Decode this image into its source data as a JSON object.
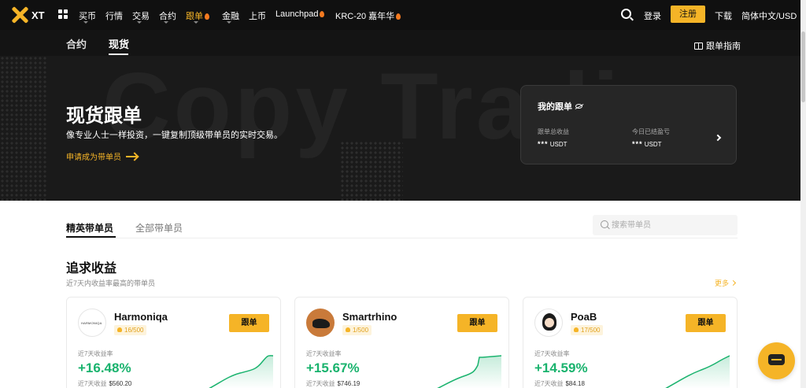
{
  "topnav": {
    "logo": "XT",
    "items": [
      {
        "label": "买币",
        "caret": true
      },
      {
        "label": "行情",
        "caret": false
      },
      {
        "label": "交易",
        "caret": true
      },
      {
        "label": "合约",
        "caret": true
      },
      {
        "label": "跟单",
        "caret": true,
        "active": true,
        "flame": true
      },
      {
        "label": "金融",
        "caret": true
      },
      {
        "label": "上币",
        "caret": false
      },
      {
        "label": "Launchpad",
        "caret": false,
        "flame": true
      },
      {
        "label": "KRC-20 嘉年华",
        "caret": false,
        "flame": true
      }
    ],
    "login": "登录",
    "signup": "注册",
    "download": "下载",
    "lang": "简体中文/USD"
  },
  "subnav": {
    "tabs": [
      "合约",
      "现货"
    ],
    "active": 1,
    "guide": "跟单指南"
  },
  "hero": {
    "bg_text": "Copy Trading",
    "title": "现货跟单",
    "desc": "像专业人士一样投资，一键复制顶级带单员的实时交易。",
    "apply": "申请成为带单员",
    "my_card": {
      "title": "我的跟单",
      "stats": [
        {
          "label": "跟单总收益",
          "value": "***",
          "unit": "USDT"
        },
        {
          "label": "今日已结盈亏",
          "value": "***",
          "unit": "USDT"
        }
      ]
    }
  },
  "leaders": {
    "tabs": [
      "精英带单员",
      "全部带单员"
    ],
    "search_placeholder": "搜索带单员"
  },
  "section": {
    "title": "追求收益",
    "subtitle": "近7天内收益率最高的带单员",
    "more": "更多"
  },
  "traders": [
    {
      "name": "Harmoniqa",
      "avatar_text": "HARMONIQA",
      "badge": "16/500",
      "follow": "跟单",
      "roi_label": "近7天收益率",
      "roi": "+16.48%",
      "pnl_label": "近7天收益",
      "pnl": "$560.20"
    },
    {
      "name": "Smartrhino",
      "avatar_text": "",
      "badge": "1/500",
      "follow": "跟单",
      "roi_label": "近7天收益率",
      "roi": "+15.67%",
      "pnl_label": "近7天收益",
      "pnl": "$746.19"
    },
    {
      "name": "PoaB",
      "avatar_text": "",
      "badge": "17/500",
      "follow": "跟单",
      "roi_label": "近7天收益率",
      "roi": "+14.59%",
      "pnl_label": "近7天收益",
      "pnl": "$84.18"
    }
  ],
  "colors": {
    "accent": "#f5b427",
    "positive": "#1ab36e",
    "dark": "#101010"
  }
}
